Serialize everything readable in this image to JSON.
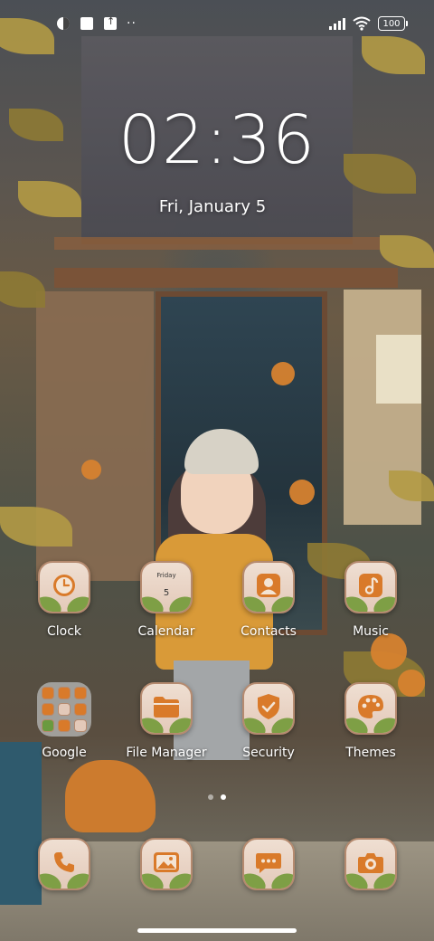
{
  "status_bar": {
    "battery": "100"
  },
  "lock_widget": {
    "time": "02:36",
    "date": "Fri, January 5"
  },
  "apps": [
    {
      "label": "Clock",
      "icon": "clock-icon"
    },
    {
      "label": "Calendar",
      "icon": "calendar-icon",
      "day_name": "Friday",
      "day_number": "5"
    },
    {
      "label": "Contacts",
      "icon": "person-icon"
    },
    {
      "label": "Music",
      "icon": "music-note-icon"
    },
    {
      "label": "Google",
      "icon": "folder-icon"
    },
    {
      "label": "File Manager",
      "icon": "folder-file-icon"
    },
    {
      "label": "Security",
      "icon": "shield-check-icon"
    },
    {
      "label": "Themes",
      "icon": "palette-icon"
    }
  ],
  "dock": [
    {
      "icon": "phone-icon"
    },
    {
      "icon": "gallery-icon"
    },
    {
      "icon": "messages-icon"
    },
    {
      "icon": "camera-icon"
    }
  ],
  "pager": {
    "pages": 2,
    "active": 1
  },
  "colors": {
    "icon_tile": "#e3c9b9",
    "icon_accent": "#d97a2a",
    "leaf_green": "#7e9f45"
  }
}
